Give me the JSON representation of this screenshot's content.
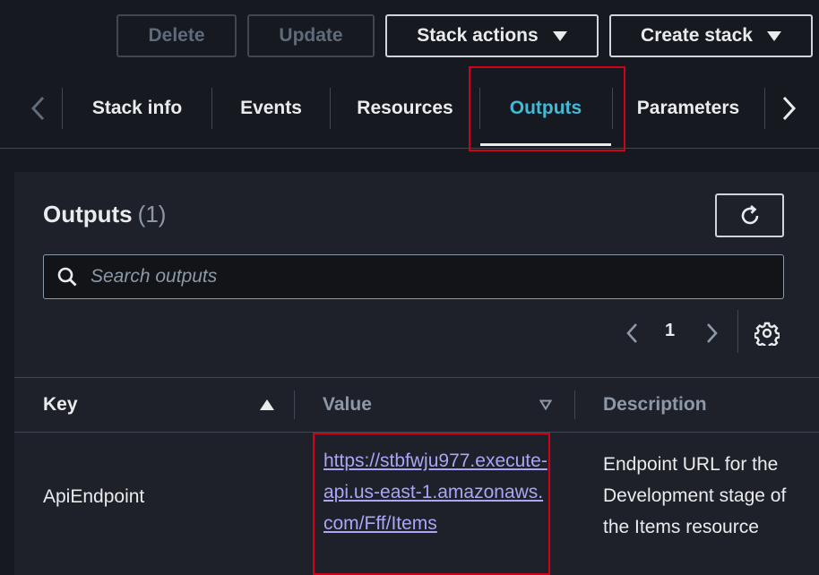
{
  "actions": {
    "delete_label": "Delete",
    "update_label": "Update",
    "stack_actions_label": "Stack actions",
    "create_stack_label": "Create stack"
  },
  "tabs": [
    {
      "label": "Stack info",
      "active": false
    },
    {
      "label": "Events",
      "active": false
    },
    {
      "label": "Resources",
      "active": false
    },
    {
      "label": "Outputs",
      "active": true
    },
    {
      "label": "Parameters",
      "active": false
    }
  ],
  "panel": {
    "title": "Outputs",
    "count": "(1)",
    "search_placeholder": "Search outputs",
    "search_value": "",
    "page_number": "1"
  },
  "table": {
    "columns": [
      "Key",
      "Value",
      "Description"
    ],
    "rows": [
      {
        "key": "ApiEndpoint",
        "value": "https://stbfwju977.execute-api.us-east-1.amazonaws.com/Fff/Items",
        "description": "Endpoint URL for the Development stage of the Items resource"
      }
    ]
  },
  "colors": {
    "background": "#16191f",
    "panel": "#1e2129",
    "active_tab": "#44b9d6",
    "link": "#a8a6f5",
    "highlight_box": "#d0021b"
  },
  "icons": {
    "tab_prev": "chevron-left-icon",
    "tab_next": "chevron-right-icon",
    "refresh": "refresh-icon",
    "search": "search-icon",
    "page_prev": "chevron-left-icon",
    "page_next": "chevron-right-icon",
    "settings": "gear-icon",
    "sort_asc": "sort-ascending-icon",
    "sort_desc": "sort-descending-icon"
  }
}
